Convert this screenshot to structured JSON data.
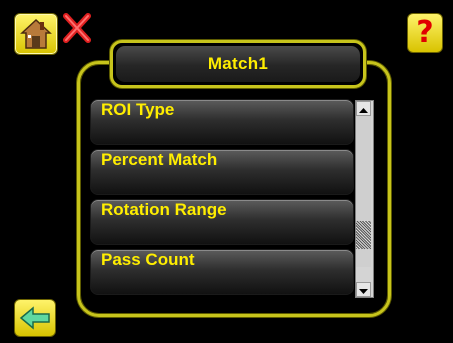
{
  "header": {
    "title": "Match1",
    "home_icon": "home-icon",
    "close_icon": "close-icon",
    "help_icon": "help-icon",
    "help_glyph": "?"
  },
  "menu": {
    "items": [
      {
        "label": "ROI Type"
      },
      {
        "label": "Percent Match"
      },
      {
        "label": "Rotation Range"
      },
      {
        "label": "Pass Count"
      }
    ]
  },
  "footer": {
    "back_icon": "back-arrow-icon"
  },
  "colors": {
    "accent": "#ffee00",
    "frame": "#c7c41c",
    "background": "#000000",
    "close": "#e02020"
  },
  "scrollbar": {
    "position_fraction": 0.85
  }
}
